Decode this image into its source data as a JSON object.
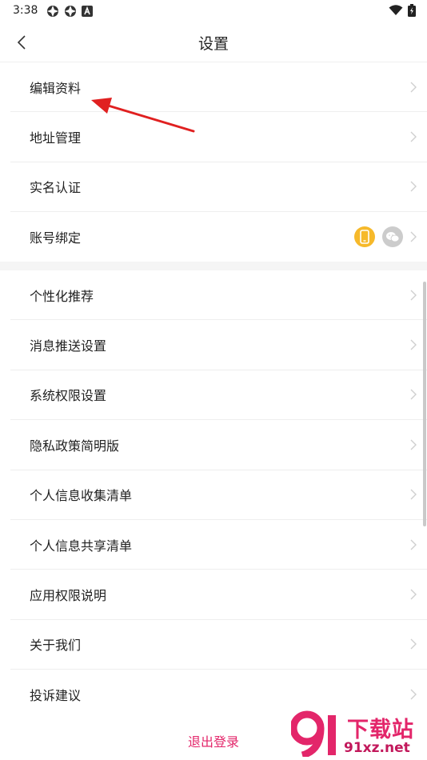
{
  "status_bar": {
    "time": "3:38"
  },
  "nav": {
    "title": "设置"
  },
  "group1": [
    {
      "label": "编辑资料"
    },
    {
      "label": "地址管理"
    },
    {
      "label": "实名认证"
    },
    {
      "label": "账号绑定"
    }
  ],
  "group2": [
    {
      "label": "个性化推荐"
    },
    {
      "label": "消息推送设置"
    },
    {
      "label": "系统权限设置"
    },
    {
      "label": "隐私政策简明版"
    },
    {
      "label": "个人信息收集清单"
    },
    {
      "label": "个人信息共享清单"
    },
    {
      "label": "应用权限说明"
    },
    {
      "label": "关于我们"
    },
    {
      "label": "投诉建议"
    }
  ],
  "logout_label": "退出登录",
  "watermark": {
    "text": "下载站",
    "url": "91xz.net",
    "logo_number": "91"
  },
  "icons": {
    "phone_bind": "phone-icon",
    "wechat_bind": "wechat-icon"
  },
  "colors": {
    "accent": "#e3266a",
    "phone_badge": "#f6b92b",
    "wechat_badge": "#cccccc",
    "annotation_arrow": "#e02020"
  }
}
